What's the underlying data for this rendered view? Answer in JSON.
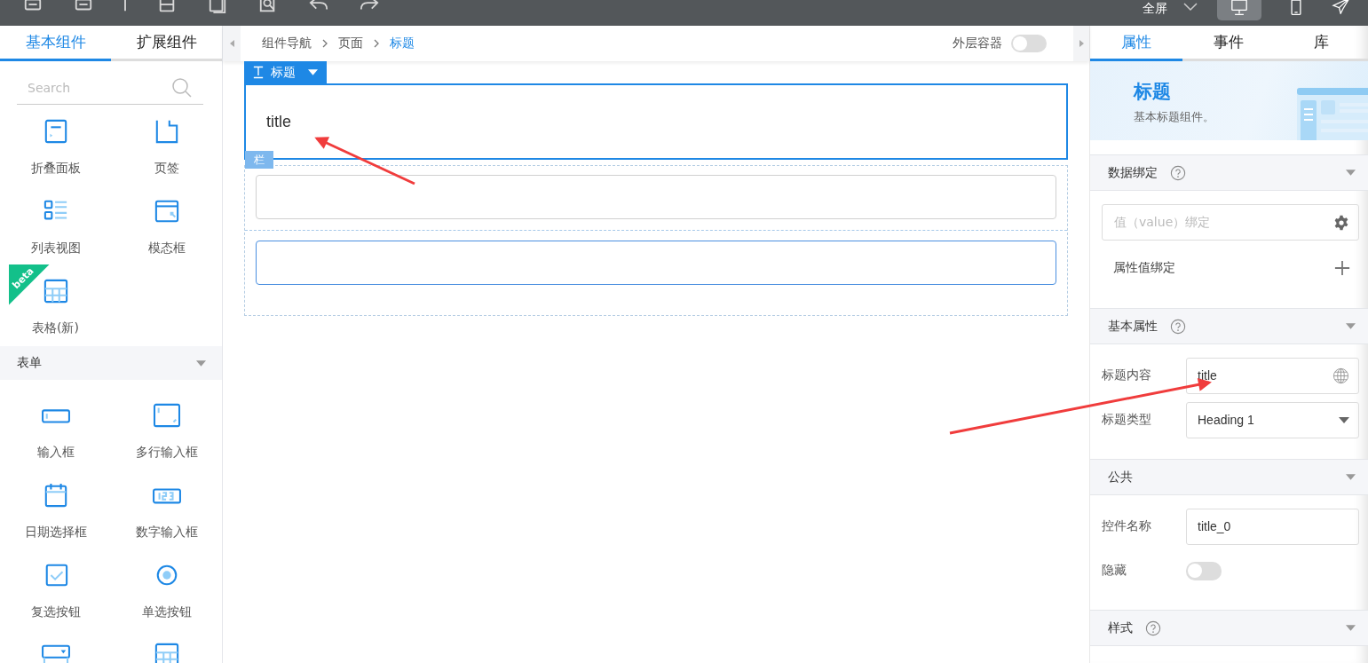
{
  "toolbar": {
    "view_mode": "全屏",
    "devices": [
      {
        "kind": "desktop",
        "selected": true
      },
      {
        "kind": "phone",
        "selected": false
      }
    ]
  },
  "left_panel": {
    "tabs": [
      {
        "label": "基本组件",
        "selected": true
      },
      {
        "label": "扩展组件",
        "selected": false
      }
    ],
    "search": {
      "placeholder": "Search"
    },
    "groups": [
      {
        "items": [
          {
            "kind": "panel",
            "label": "折叠面板"
          },
          {
            "kind": "tabs",
            "label": "页签"
          },
          {
            "kind": "list",
            "label": "列表视图"
          },
          {
            "kind": "modal",
            "label": "模态框"
          },
          {
            "kind": "table",
            "label": "表格(新)",
            "badge": "beta"
          }
        ]
      },
      {
        "title": "表单",
        "expanded": true,
        "items": [
          {
            "kind": "input",
            "label": "输入框"
          },
          {
            "kind": "textarea",
            "label": "多行输入框"
          },
          {
            "kind": "date",
            "label": "日期选择框"
          },
          {
            "kind": "number",
            "label": "数字输入框"
          },
          {
            "kind": "checkbox",
            "label": "复选按钮"
          },
          {
            "kind": "radio",
            "label": "单选按钮"
          },
          {
            "kind": "select"
          },
          {
            "kind": "grid"
          }
        ]
      }
    ]
  },
  "canvas": {
    "breadcrumb": [
      {
        "label": "组件导航",
        "selected": false
      },
      {
        "label": "页面",
        "selected": false
      },
      {
        "label": "标题",
        "selected": true
      }
    ],
    "outer_container": {
      "label": "外层容器",
      "on": false
    },
    "component_tag": "标题",
    "title_text": "title",
    "column_tag": "栏",
    "inputs": [
      {
        "focused": false
      },
      {
        "focused": true
      }
    ]
  },
  "properties_panel": {
    "tabs": [
      {
        "label": "属性",
        "selected": true
      },
      {
        "label": "事件",
        "selected": false
      },
      {
        "label": "库",
        "selected": false
      }
    ],
    "banner": {
      "title": "标题",
      "description": "基本标题组件。"
    },
    "sections": [
      {
        "title": "数据绑定",
        "help": true,
        "rows": [
          {
            "kind": "binding",
            "placeholder": "值（value）绑定"
          },
          {
            "kind": "add",
            "label": "属性值绑定"
          }
        ]
      },
      {
        "title": "基本属性",
        "help": true,
        "rows": [
          {
            "kind": "text",
            "label": "标题内容",
            "value": "title",
            "globe": true
          },
          {
            "kind": "select",
            "label": "标题类型",
            "value": "Heading 1"
          }
        ]
      },
      {
        "title": "公共",
        "help": false,
        "rows": [
          {
            "kind": "text",
            "label": "控件名称",
            "value": "title_0",
            "globe": false
          },
          {
            "kind": "switch",
            "label": "隐藏",
            "on": false
          }
        ]
      },
      {
        "title": "样式",
        "help": true
      }
    ]
  }
}
